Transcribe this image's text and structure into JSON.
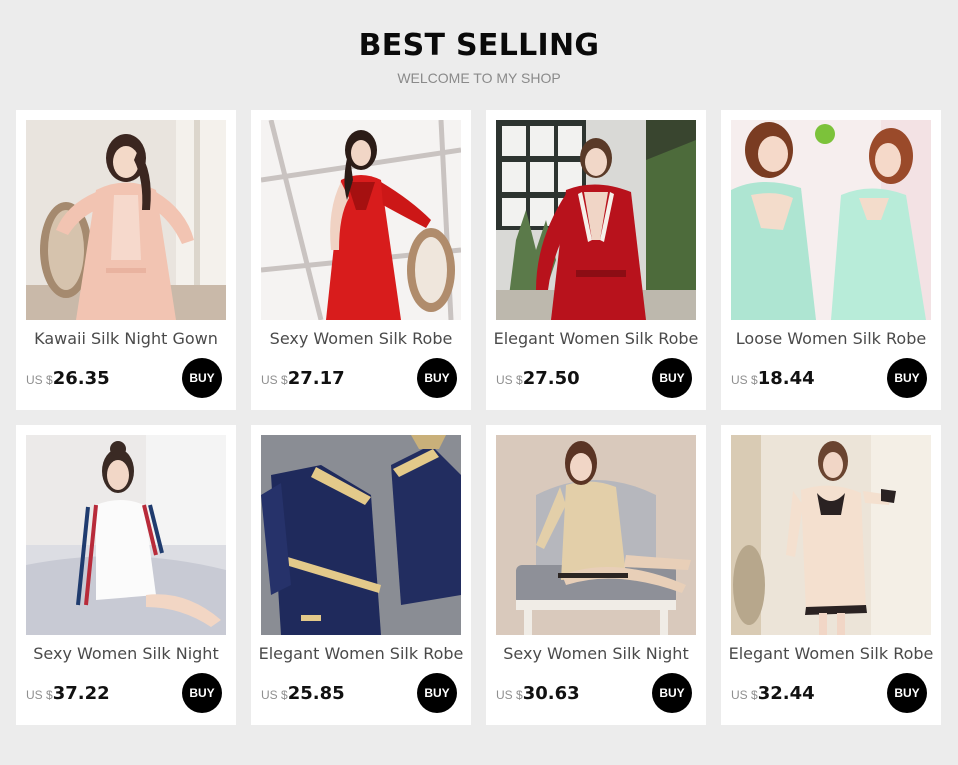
{
  "header": {
    "title": "BEST SELLING",
    "subtitle": "WELCOME TO MY SHOP"
  },
  "products": [
    {
      "name": "Kawaii Silk Night Gown",
      "currency": "US $",
      "price": "26.35",
      "buy_label": "BUY",
      "image": "model-in-peach-silk-robe"
    },
    {
      "name": "Sexy Women Silk Robe",
      "currency": "US $",
      "price": "27.17",
      "buy_label": "BUY",
      "image": "model-in-red-silk-nightdress"
    },
    {
      "name": "Elegant Women Silk Robe",
      "currency": "US $",
      "price": "27.50",
      "buy_label": "BUY",
      "image": "model-in-red-robe-with-lace"
    },
    {
      "name": "Loose Women Silk Robe",
      "currency": "US $",
      "price": "18.44",
      "buy_label": "BUY",
      "image": "two-models-in-mint-robes"
    },
    {
      "name": "Sexy Women Silk Night",
      "currency": "US $",
      "price": "37.22",
      "buy_label": "BUY",
      "image": "model-in-striped-robe-on-bed"
    },
    {
      "name": "Elegant Women Silk Robe",
      "currency": "US $",
      "price": "25.85",
      "buy_label": "BUY",
      "image": "navy-robe-with-gold-lace-flatlay"
    },
    {
      "name": "Sexy Women Silk Night",
      "currency": "US $",
      "price": "30.63",
      "buy_label": "BUY",
      "image": "model-in-champagne-robe-on-chair"
    },
    {
      "name": "Elegant Women Silk Robe",
      "currency": "US $",
      "price": "32.44",
      "buy_label": "BUY",
      "image": "model-in-cream-robe-with-black-lace"
    }
  ]
}
